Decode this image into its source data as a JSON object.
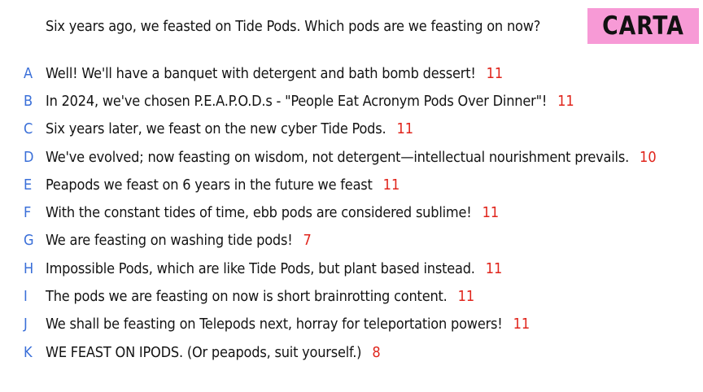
{
  "question": "Six years ago, we feasted on Tide Pods. Which pods are we feasting on now?",
  "brand": "CARTA",
  "answers": [
    {
      "letter": "A",
      "text": "Well! We'll have a banquet with detergent and bath bomb dessert!",
      "score": "11"
    },
    {
      "letter": "B",
      "text": "In 2024, we've chosen P.E.A.P.O.D.s - \"People Eat Acronym Pods Over Dinner\"!",
      "score": "11"
    },
    {
      "letter": "C",
      "text": "Six years later, we feast on the new cyber Tide Pods.",
      "score": "11"
    },
    {
      "letter": "D",
      "text": "We've evolved; now feasting on wisdom, not detergent—intellectual nourishment prevails.",
      "score": "10"
    },
    {
      "letter": "E",
      "text": "Peapods we feast on 6 years in the future we feast",
      "score": "11"
    },
    {
      "letter": "F",
      "text": "With the constant tides of time, ebb pods are considered sublime!",
      "score": "11"
    },
    {
      "letter": "G",
      "text": "We are feasting on washing tide pods!",
      "score": "7"
    },
    {
      "letter": "H",
      "text": "Impossible Pods, which are like Tide Pods, but plant based instead.",
      "score": "11"
    },
    {
      "letter": "I",
      "text": "The pods we are feasting on now is short brainrotting content.",
      "score": "11"
    },
    {
      "letter": "J",
      "text": "We shall be feasting on Telepods next, horray for teleportation powers!",
      "score": "11"
    },
    {
      "letter": "K",
      "text": "WE FEAST ON IPODS. (Or peapods, suit yourself.)",
      "score": "8"
    }
  ]
}
